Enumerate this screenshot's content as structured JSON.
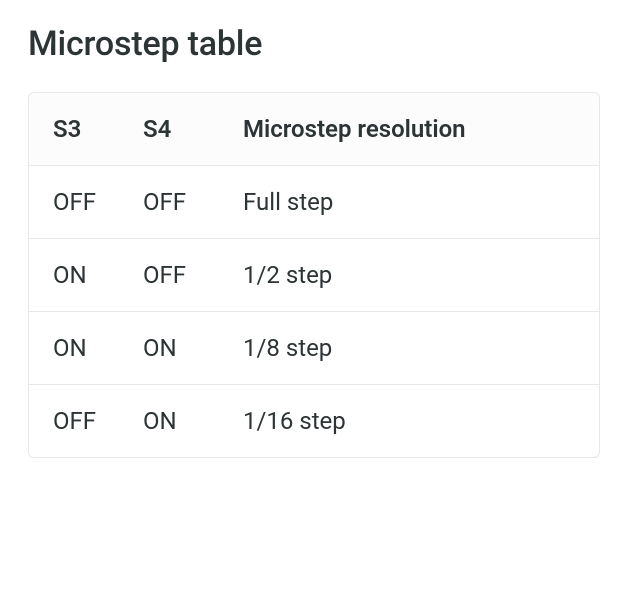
{
  "title": "Microstep table",
  "chart_data": {
    "type": "table",
    "columns": [
      "S3",
      "S4",
      "Microstep resolution"
    ],
    "rows": [
      [
        "OFF",
        "OFF",
        "Full step"
      ],
      [
        "ON",
        "OFF",
        "1/2 step"
      ],
      [
        "ON",
        "ON",
        "1/8 step"
      ],
      [
        "OFF",
        "ON",
        "1/16 step"
      ]
    ]
  }
}
